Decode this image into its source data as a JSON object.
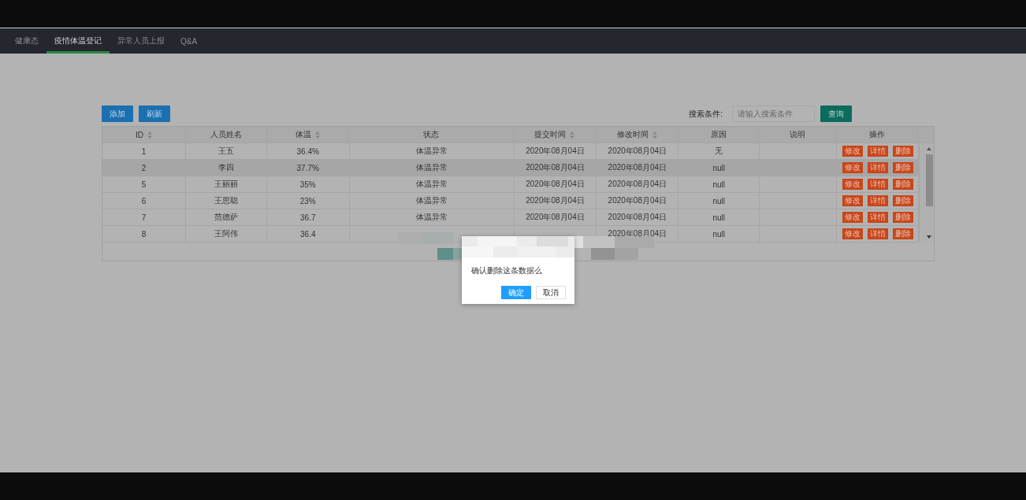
{
  "tabs": [
    {
      "label": "健康态",
      "selected": false
    },
    {
      "label": "疫情体温登记",
      "selected": true
    },
    {
      "label": "异常人员上报",
      "selected": false
    },
    {
      "label": "Q&A",
      "selected": false
    }
  ],
  "toolbar": {
    "buttons": [
      "添加",
      "刷新"
    ],
    "search_label": "搜索条件:",
    "search": {
      "placeholder": "请输入搜索条件"
    },
    "search_button": "查询"
  },
  "table": {
    "columns": [
      {
        "label": "ID",
        "sortable": true
      },
      {
        "label": "人员姓名",
        "sortable": false
      },
      {
        "label": "体温",
        "sortable": true
      },
      {
        "label": "状态",
        "sortable": false
      },
      {
        "label": "提交时间",
        "sortable": true
      },
      {
        "label": "修改时间",
        "sortable": true
      },
      {
        "label": "原因",
        "sortable": false
      },
      {
        "label": "说明",
        "sortable": false
      },
      {
        "label": "操作",
        "sortable": false
      }
    ],
    "rows": [
      {
        "id": "1",
        "name": "王五",
        "temp": "36.4%",
        "status": "体温异常",
        "submitted": "2020年08月04日",
        "modified": "2020年08月04日",
        "reason": "无",
        "highlighted": false,
        "actions": [
          "修改",
          "详情",
          "删除"
        ]
      },
      {
        "id": "2",
        "name": "李四",
        "temp": "37.7%",
        "status": "体温异常",
        "submitted": "2020年08月04日",
        "modified": "2020年08月04日",
        "reason": "null",
        "highlighted": true,
        "actions": [
          "修改",
          "详情",
          "删除"
        ]
      },
      {
        "id": "5",
        "name": "王丽丽",
        "temp": "35%",
        "status": "体温异常",
        "submitted": "2020年08月04日",
        "modified": "2020年08月04日",
        "reason": "null",
        "highlighted": false,
        "actions": [
          "修改",
          "详情",
          "删除"
        ]
      },
      {
        "id": "6",
        "name": "王思聪",
        "temp": "23%",
        "status": "体温异常",
        "submitted": "2020年08月04日",
        "modified": "2020年08月04日",
        "reason": "null",
        "highlighted": false,
        "actions": [
          "修改",
          "详情",
          "删除"
        ]
      },
      {
        "id": "7",
        "name": "范德萨",
        "temp": "36.7",
        "status": "体温异常",
        "submitted": "2020年08月04日",
        "modified": "2020年08月04日",
        "reason": "null",
        "highlighted": false,
        "actions": [
          "修改",
          "详情",
          "删除"
        ]
      },
      {
        "id": "8",
        "name": "王阿伟",
        "temp": "36.4",
        "modified": "2020年08月04日",
        "reason": "null",
        "highlighted": false,
        "actions": [
          "修改",
          "详情",
          "删除"
        ]
      }
    ]
  },
  "dialog": {
    "message": "确认删除这条数据么",
    "buttons": [
      {
        "label": "确定",
        "kind": "primary"
      },
      {
        "label": "取消",
        "kind": "secondary"
      }
    ]
  }
}
